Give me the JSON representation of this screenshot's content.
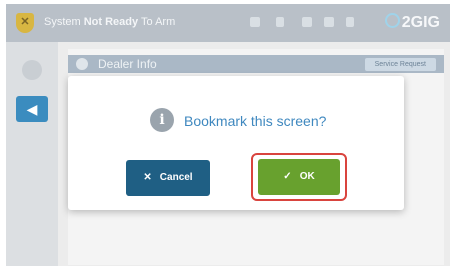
{
  "status_bar": {
    "status_prefix": "System ",
    "status_bold": "Not Ready",
    "status_suffix": " To Arm",
    "brand": "2GIG"
  },
  "background": {
    "page_title": "Dealer Info",
    "service_request_label": "Service Request"
  },
  "dialog": {
    "message": "Bookmark this screen?",
    "cancel_label": "Cancel",
    "ok_label": "OK"
  },
  "icons": {
    "shield": "shield-icon",
    "back": "back-arrow-icon",
    "info": "info-icon",
    "cancel": "close-icon",
    "ok": "check-icon"
  },
  "colors": {
    "status_bar": "#b9c0c8",
    "accent_blue": "#3f88bf",
    "cancel_button": "#1f5f84",
    "ok_button": "#68a12e",
    "highlight": "#d9443e"
  }
}
